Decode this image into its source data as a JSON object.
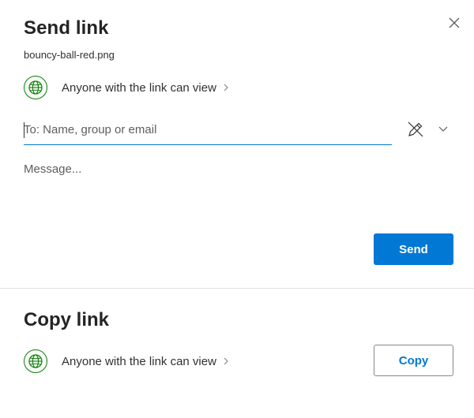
{
  "dialog": {
    "close_icon": "close-icon"
  },
  "send_link": {
    "title": "Send link",
    "filename": "bouncy-ball-red.png",
    "permission": {
      "icon": "globe-icon",
      "label": "Anyone with the link can view",
      "chevron_icon": "chevron-right-icon"
    },
    "to_field": {
      "placeholder": "To: Name, group or email",
      "value": ""
    },
    "contact_picker": {
      "icon": "pencil-icon",
      "dropdown_icon": "chevron-down-icon"
    },
    "message": {
      "placeholder": "Message...",
      "value": ""
    },
    "send_label": "Send"
  },
  "copy_link": {
    "title": "Copy link",
    "permission": {
      "icon": "globe-icon",
      "label": "Anyone with the link can view",
      "chevron_icon": "chevron-right-icon"
    },
    "copy_label": "Copy"
  },
  "colors": {
    "accent": "#0078d4",
    "globe_green": "#107c10",
    "divider": "#e1dfdd"
  }
}
